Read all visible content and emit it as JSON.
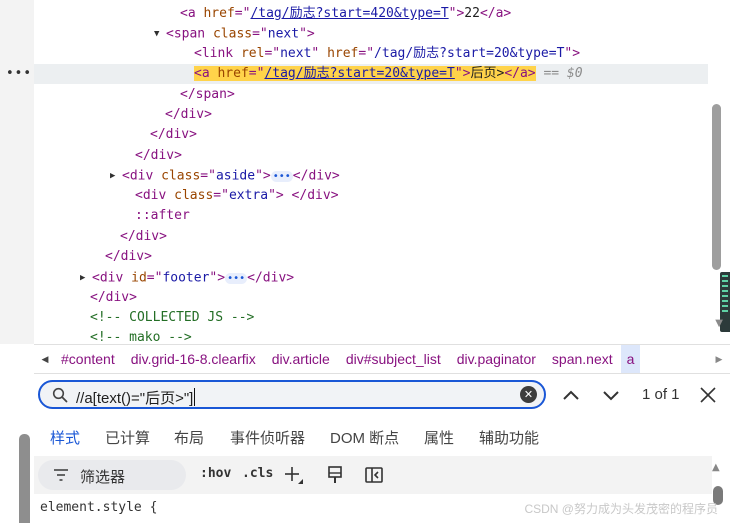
{
  "dom_tree": {
    "lines": [
      {
        "tri": "",
        "tokens": [
          [
            "tag",
            "<a "
          ],
          [
            "attr",
            "href"
          ],
          [
            "tag",
            "=\""
          ],
          [
            "link",
            "/tag/励志?start=420&type=T"
          ],
          [
            "tag",
            "\">"
          ],
          [
            "txt",
            "22"
          ],
          [
            "tag",
            "</a>"
          ]
        ]
      },
      {
        "tri": "▼",
        "tokens": [
          [
            "tag",
            "<span "
          ],
          [
            "attr",
            "class"
          ],
          [
            "tag",
            "=\""
          ],
          [
            "val",
            "next"
          ],
          [
            "tag",
            "\">"
          ]
        ]
      },
      {
        "tri": "",
        "tokens": [
          [
            "tag",
            "<link "
          ],
          [
            "attr",
            "rel"
          ],
          [
            "tag",
            "=\""
          ],
          [
            "val",
            "next"
          ],
          [
            "tag",
            "\" "
          ],
          [
            "attr",
            "href"
          ],
          [
            "tag",
            "=\""
          ],
          [
            "val",
            "/tag/励志?start=20&type=T"
          ],
          [
            "tag",
            "\">"
          ]
        ]
      },
      {
        "tri": "",
        "selected": true,
        "tokens": [
          [
            "hl-tag",
            "<a "
          ],
          [
            "hl-attr",
            "href"
          ],
          [
            "hl-tag",
            "=\""
          ],
          [
            "hl-link",
            "/tag/励志?start=20&type=T"
          ],
          [
            "hl-tag",
            "\">"
          ],
          [
            "hl-txt",
            "后页>"
          ],
          [
            "hl-tag",
            "</a>"
          ],
          [
            "dim",
            " == $0"
          ]
        ]
      },
      {
        "tri": "",
        "tokens": [
          [
            "tag",
            "</span>"
          ]
        ]
      },
      {
        "tri": "",
        "tokens": [
          [
            "tag",
            "</div>"
          ]
        ]
      },
      {
        "tri": "",
        "tokens": [
          [
            "tag",
            "</div>"
          ]
        ]
      },
      {
        "tri": "",
        "tokens": [
          [
            "tag",
            "</div>"
          ]
        ]
      },
      {
        "tri": "▶",
        "tokens": [
          [
            "tag",
            "<div "
          ],
          [
            "attr",
            "class"
          ],
          [
            "tag",
            "=\""
          ],
          [
            "val",
            "aside"
          ],
          [
            "tag",
            "\">"
          ],
          [
            "pill",
            "•••"
          ],
          [
            "tag",
            "</div>"
          ]
        ]
      },
      {
        "tri": "",
        "tokens": [
          [
            "tag",
            "<div "
          ],
          [
            "attr",
            "class"
          ],
          [
            "tag",
            "=\""
          ],
          [
            "val",
            "extra"
          ],
          [
            "tag",
            "\"> </div>"
          ]
        ]
      },
      {
        "tri": "",
        "tokens": [
          [
            "pseudo",
            "::after"
          ]
        ]
      },
      {
        "tri": "",
        "tokens": [
          [
            "tag",
            "</div>"
          ]
        ]
      },
      {
        "tri": "",
        "tokens": [
          [
            "tag",
            "</div>"
          ]
        ]
      },
      {
        "tri": "▶",
        "tokens": [
          [
            "tag",
            "<div "
          ],
          [
            "attr",
            "id"
          ],
          [
            "tag",
            "=\""
          ],
          [
            "val",
            "footer"
          ],
          [
            "tag",
            "\">"
          ],
          [
            "pill",
            "•••"
          ],
          [
            "tag",
            "</div>"
          ]
        ]
      },
      {
        "tri": "",
        "tokens": [
          [
            "tag",
            "</div>"
          ]
        ]
      },
      {
        "tri": "",
        "tokens": [
          [
            "cmt",
            "<!-- COLLECTED JS -->"
          ]
        ]
      },
      {
        "tri": "",
        "tokens": [
          [
            "cmt",
            "<!-- mako -->"
          ]
        ]
      }
    ],
    "gutter_marker": "•••"
  },
  "breadcrumb": {
    "items": [
      "#content",
      "div.grid-16-8.clearfix",
      "div.article",
      "div#subject_list",
      "div.paginator",
      "span.next",
      "a"
    ],
    "active_index": 6
  },
  "search": {
    "value": "//a[text()=\"后页>\"]",
    "match_count": "1 of 1"
  },
  "tabs": {
    "items": [
      "样式",
      "已计算",
      "布局",
      "事件侦听器",
      "DOM 断点",
      "属性",
      "辅助功能"
    ],
    "active_index": 0
  },
  "toolbar": {
    "filter_label": "筛选器",
    "hov_label": ":hov",
    "cls_label": ".cls"
  },
  "styles": {
    "element_style": "element.style {"
  },
  "watermark": "CSDN @努力成为头发茂密的程序员",
  "colors": {
    "accent": "#1a57d6",
    "highlight": "#ffd34a",
    "tag": "#881280",
    "attribute": "#994500",
    "value": "#1a1aa6",
    "comment": "#236e25"
  }
}
